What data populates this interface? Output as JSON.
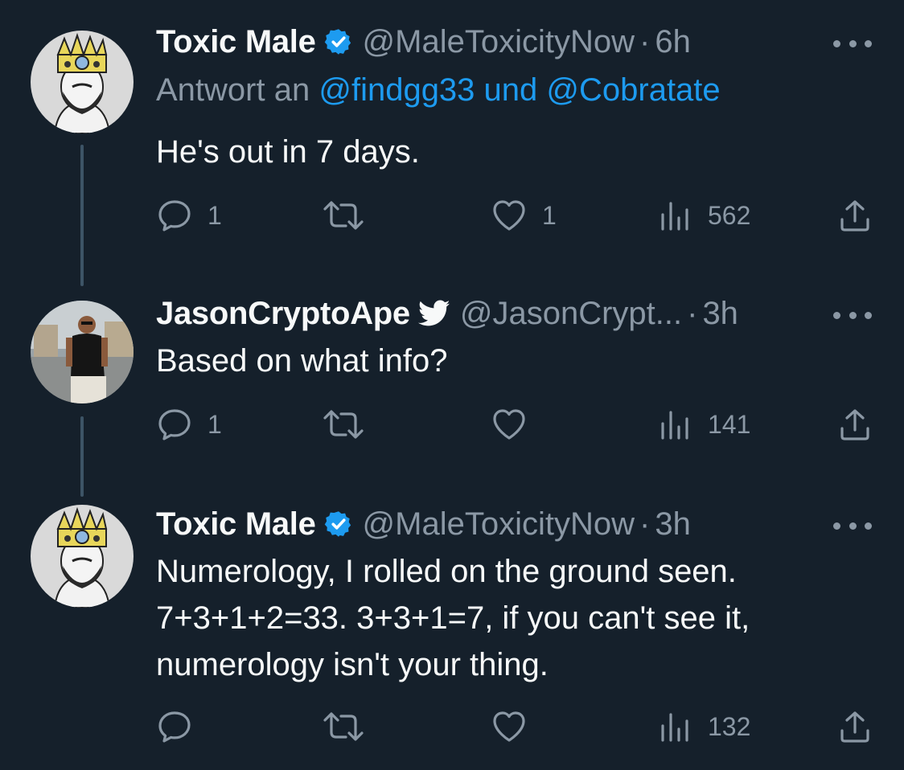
{
  "colors": {
    "background": "#15202b",
    "primary_text": "#f7f9f9",
    "secondary_text": "#8b98a5",
    "link": "#1d9bf0",
    "verified_badge": "#1d9bf0",
    "thread_line": "#3d5466"
  },
  "tweets": [
    {
      "display_name": "Toxic Male",
      "badge_icon": "verified-badge-icon",
      "handle": "@MaleToxicityNow",
      "separator": "·",
      "time": "6h",
      "reply_prefix": "Antwort an",
      "reply_mentions": "@findgg33 und @Cobratate",
      "text": "He's out in 7 days.",
      "reply_count": "1",
      "retweet_count": "",
      "like_count": "1",
      "view_count": "562"
    },
    {
      "display_name": "JasonCryptoApe",
      "badge_icon": "twitter-bird-icon",
      "handle": "@JasonCrypt...",
      "separator": "·",
      "time": "3h",
      "text": "Based on what info?",
      "reply_count": "1",
      "retweet_count": "",
      "like_count": "",
      "view_count": "141"
    },
    {
      "display_name": "Toxic Male",
      "badge_icon": "verified-badge-icon",
      "handle": "@MaleToxicityNow",
      "separator": "·",
      "time": "3h",
      "text": "Numerology, I rolled on the ground seen.\n7+3+1+2=33.  3+3+1=7, if you can't see it,\nnumerology isn't your thing.",
      "reply_count": "",
      "retweet_count": "",
      "like_count": "",
      "view_count": "132"
    }
  ]
}
